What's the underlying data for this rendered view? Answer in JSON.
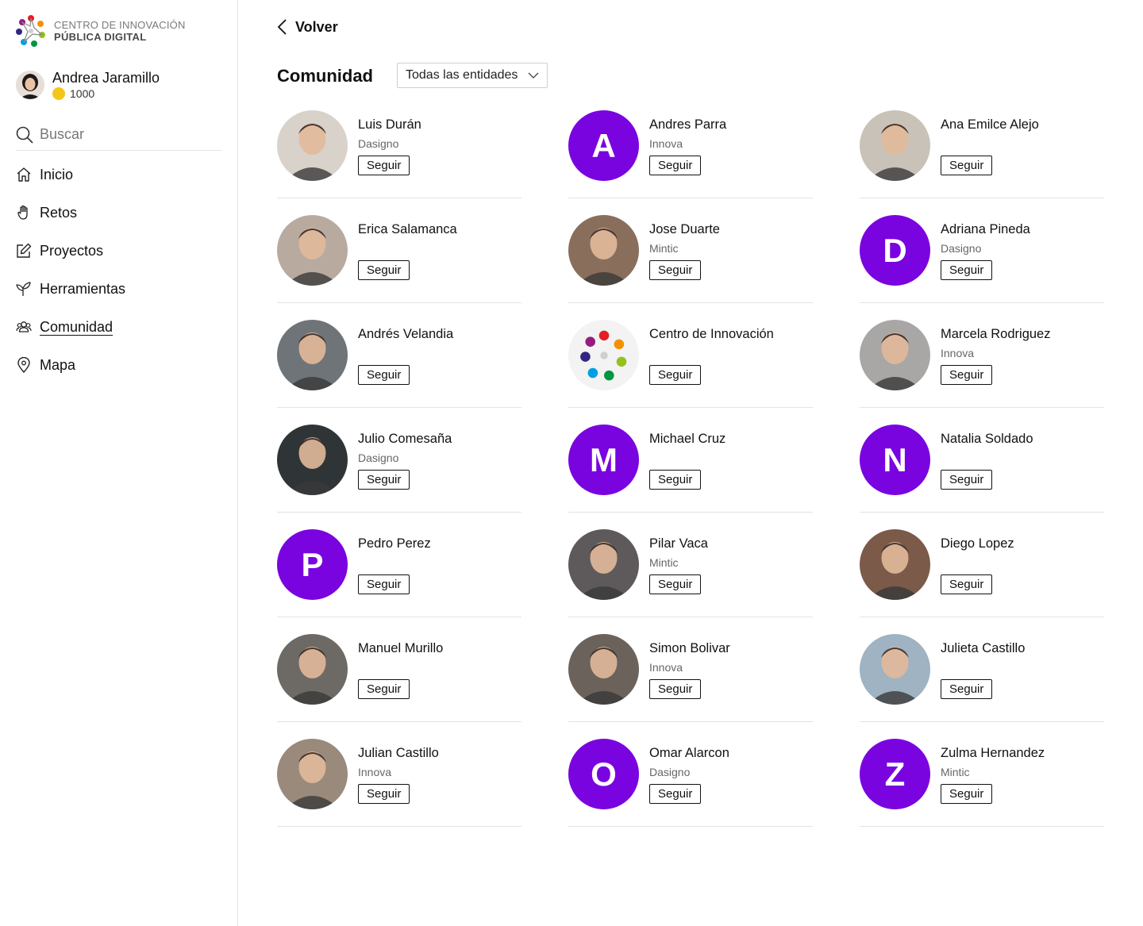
{
  "brand": {
    "line1": "CENTRO DE INNOVACIÓN",
    "line2": "PÚBLICA DIGITAL"
  },
  "user": {
    "name": "Andrea Jaramillo",
    "coins": "1000"
  },
  "search": {
    "placeholder": "Buscar"
  },
  "nav": [
    {
      "label": "Inicio",
      "icon": "home-icon"
    },
    {
      "label": "Retos",
      "icon": "hand-icon"
    },
    {
      "label": "Proyectos",
      "icon": "edit-icon"
    },
    {
      "label": "Herramientas",
      "icon": "sprout-icon"
    },
    {
      "label": "Comunidad",
      "icon": "people-icon",
      "active": true
    },
    {
      "label": "Mapa",
      "icon": "map-pin-icon"
    }
  ],
  "back_label": "Volver",
  "page_title": "Comunidad",
  "filter": {
    "selected": "Todas las entidades"
  },
  "follow_label": "Seguir",
  "accent_color": "#7a04e0",
  "members": [
    {
      "name": "Luis Durán",
      "entity": "Dasigno",
      "avatar": "photo",
      "tone": "#d9d2cb"
    },
    {
      "name": "Andres Parra",
      "entity": "Innova",
      "avatar": "letter",
      "letter": "A"
    },
    {
      "name": "Ana Emilce Alejo",
      "entity": "",
      "avatar": "photo",
      "tone": "#c9c2b8"
    },
    {
      "name": "Erica Salamanca",
      "entity": "",
      "avatar": "photo",
      "tone": "#b9aaa0"
    },
    {
      "name": "Jose Duarte",
      "entity": "Mintic",
      "avatar": "photo",
      "tone": "#8a6e5c"
    },
    {
      "name": "Adriana Pineda",
      "entity": "Dasigno",
      "avatar": "letter",
      "letter": "D"
    },
    {
      "name": "Andrés Velandia",
      "entity": "",
      "avatar": "photo",
      "tone": "#6f7478"
    },
    {
      "name": "Centro de Innovación",
      "entity": "",
      "avatar": "org"
    },
    {
      "name": "Marcela Rodriguez",
      "entity": "Innova",
      "avatar": "photo",
      "tone": "#a9a6a6"
    },
    {
      "name": "Julio Comesaña",
      "entity": "Dasigno",
      "avatar": "photo",
      "tone": "#2f3437"
    },
    {
      "name": "Michael Cruz",
      "entity": "",
      "avatar": "letter",
      "letter": "M"
    },
    {
      "name": "Natalia Soldado",
      "entity": "",
      "avatar": "letter",
      "letter": "N"
    },
    {
      "name": "Pedro Perez",
      "entity": "",
      "avatar": "letter",
      "letter": "P"
    },
    {
      "name": "Pilar Vaca",
      "entity": "Mintic",
      "avatar": "photo",
      "tone": "#5e5a5c"
    },
    {
      "name": "Diego Lopez",
      "entity": "",
      "avatar": "photo",
      "tone": "#7b5a4a"
    },
    {
      "name": "Manuel Murillo",
      "entity": "",
      "avatar": "photo",
      "tone": "#6d6a66"
    },
    {
      "name": "Simon Bolivar",
      "entity": "Innova",
      "avatar": "photo",
      "tone": "#6b625c"
    },
    {
      "name": "Julieta Castillo",
      "entity": "",
      "avatar": "photo",
      "tone": "#9fb3c2"
    },
    {
      "name": "Julian Castillo",
      "entity": "Innova",
      "avatar": "photo",
      "tone": "#9a8a7c"
    },
    {
      "name": "Omar Alarcon",
      "entity": "Dasigno",
      "avatar": "letter",
      "letter": "O"
    },
    {
      "name": "Zulma Hernandez",
      "entity": "Mintic",
      "avatar": "letter",
      "letter": "Z"
    }
  ]
}
